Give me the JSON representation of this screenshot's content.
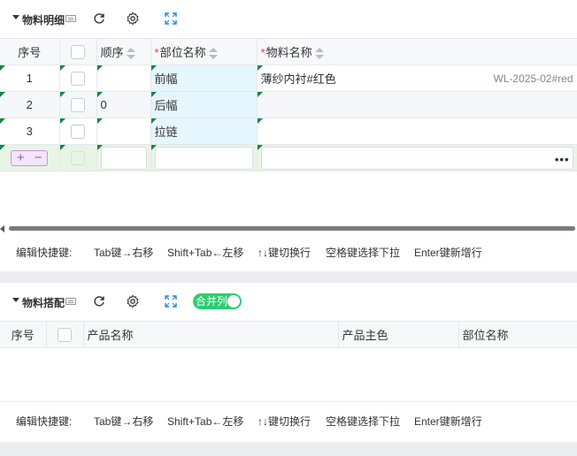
{
  "panel1": {
    "title": "物料明细",
    "columns": {
      "index": "序号",
      "order": "顺序",
      "part_name": "部位名称",
      "material_name": "物料名称"
    },
    "rows": [
      {
        "index": "1",
        "order": "",
        "part_name": "前幅",
        "material_name": "薄纱内衬#红色",
        "material_code": "WL-2025-02#red"
      },
      {
        "index": "2",
        "order": "0",
        "part_name": "后幅",
        "material_name": "",
        "material_code": ""
      },
      {
        "index": "3",
        "order": "",
        "part_name": "拉链",
        "material_name": "",
        "material_code": ""
      }
    ],
    "new_row": {
      "add_label": "+",
      "remove_label": "−",
      "more_label": "•••"
    }
  },
  "panel2": {
    "title": "物料搭配",
    "merge_toggle_label": "合并列",
    "merge_toggle_on": true,
    "columns": {
      "index": "序号",
      "product_name": "产品名称",
      "product_color": "产品主色",
      "part_name": "部位名称"
    }
  },
  "shortcuts": {
    "label": "编辑快捷键:",
    "tab": "Tab键→右移",
    "shift_tab": "Shift+Tab←左移",
    "arrows": "↑↓键切换行",
    "space": "空格键选择下拉",
    "enter": "Enter键新增行"
  },
  "icons": {
    "collapse": "caret-down-icon",
    "keyboard": "keyboard-icon",
    "refresh": "refresh-icon",
    "settings": "gear-icon",
    "fullscreen": "fullscreen-icon",
    "more": "ellipsis-icon"
  },
  "colors": {
    "accent_blue": "#1e88e5",
    "required": "#e53935",
    "toggle_on": "#2ecc71",
    "highlight_column": "#e6f6ff",
    "new_row": "#e9f5e4",
    "add_remove": "#a14fc4"
  }
}
